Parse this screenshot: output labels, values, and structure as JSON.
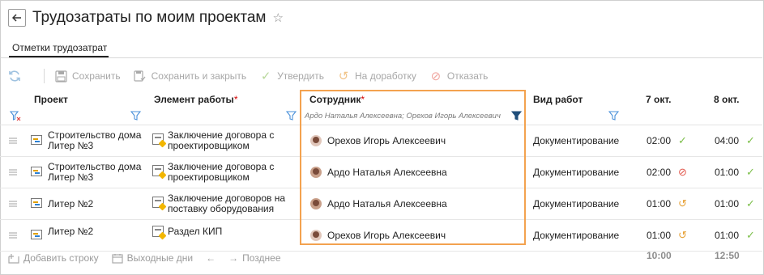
{
  "header": {
    "title": "Трудозатраты по моим проектам"
  },
  "tabs": [
    {
      "label": "Отметки трудозатрат"
    }
  ],
  "toolbar": {
    "save": "Сохранить",
    "save_close": "Сохранить и закрыть",
    "approve": "Утвердить",
    "rework": "На доработку",
    "reject": "Отказать"
  },
  "columns": {
    "project": "Проект",
    "work_item": "Элемент работы",
    "employee": "Сотрудник",
    "work_type": "Вид работ",
    "day1": "7 окт.",
    "day2": "8 окт.",
    "required_mark": "*"
  },
  "filter": {
    "employee": "Ардо Наталья Алексеевна; Орехов Игорь Алексеевич"
  },
  "rows": [
    {
      "project": "Строительство дома Литер №3",
      "work_item": "Заключение договора с проектировщиком",
      "employee": "Орехов Игорь Алексеевич",
      "work_type": "Документирование",
      "d1": "02:00",
      "d1_status": "approved",
      "d1_glyph": "✓",
      "d2": "04:00",
      "d2_status": "approved",
      "d2_glyph": "✓"
    },
    {
      "project": "Строительство дома Литер №3",
      "work_item": "Заключение договора с проектировщиком",
      "employee": "Ардо Наталья Алексеевна",
      "work_type": "Документирование",
      "d1": "02:00",
      "d1_status": "rejected",
      "d1_glyph": "⊘",
      "d2": "01:00",
      "d2_status": "approved",
      "d2_glyph": "✓"
    },
    {
      "project": "Литер №2",
      "work_item": "Заключение договоров на поставку оборудования",
      "employee": "Ардо Наталья Алексеевна",
      "work_type": "Документирование",
      "d1": "01:00",
      "d1_status": "rework",
      "d1_glyph": "↺",
      "d2": "01:00",
      "d2_status": "approved",
      "d2_glyph": "✓"
    },
    {
      "project": "Литер №2",
      "work_item": "Раздел КИП",
      "employee": "Орехов Игорь Алексеевич",
      "work_type": "Документирование",
      "d1": "01:00",
      "d1_status": "rework",
      "d1_glyph": "↺",
      "d2": "01:00",
      "d2_status": "approved",
      "d2_glyph": "✓"
    }
  ],
  "footer": {
    "add_row": "Добавить строку",
    "weekends": "Выходные дни",
    "later": "Позднее",
    "total_day1": "10:00",
    "total_day2": "12:50"
  },
  "colors": {
    "accent_highlight": "#f3a24f",
    "approved": "#7cbf4a",
    "rejected": "#e2574c",
    "rework": "#e7a33a",
    "required": "#d40000"
  },
  "icons": [
    "back-arrow-icon",
    "star-icon",
    "refresh-icon",
    "save-icon",
    "save-close-icon",
    "check-icon",
    "undo-icon",
    "forbidden-icon",
    "filter-icon",
    "clear-filter-icon",
    "drag-handle-icon",
    "project-icon",
    "work-item-icon",
    "avatar",
    "add-row-icon",
    "calendar-icon",
    "arrow-left-icon",
    "arrow-right-icon"
  ]
}
